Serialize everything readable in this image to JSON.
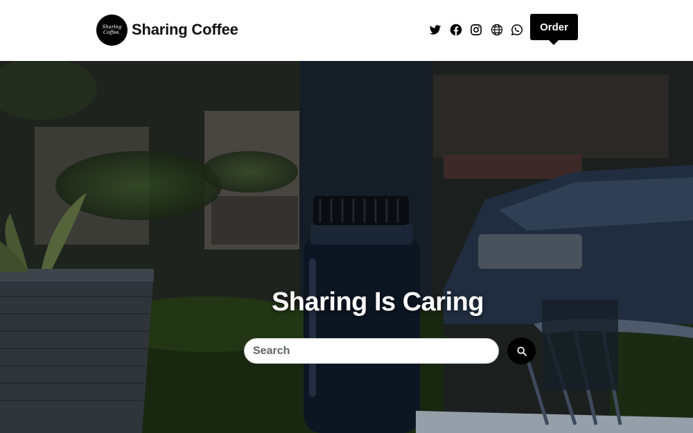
{
  "header": {
    "logo_text_line1": "Sharing",
    "logo_text_line2": "Coffee.",
    "brand_name": "Sharing Coffee",
    "socials": [
      "twitter-icon",
      "facebook-icon",
      "instagram-icon",
      "globe-icon",
      "whatsapp-icon"
    ],
    "order_label": "Order"
  },
  "hero": {
    "title": "Sharing Is Caring",
    "search": {
      "placeholder": "Search",
      "value": ""
    },
    "search_icon": "search-icon"
  },
  "colors": {
    "primary": "#000000",
    "header_bg": "#ffffff",
    "hero_text": "#ffffff"
  }
}
